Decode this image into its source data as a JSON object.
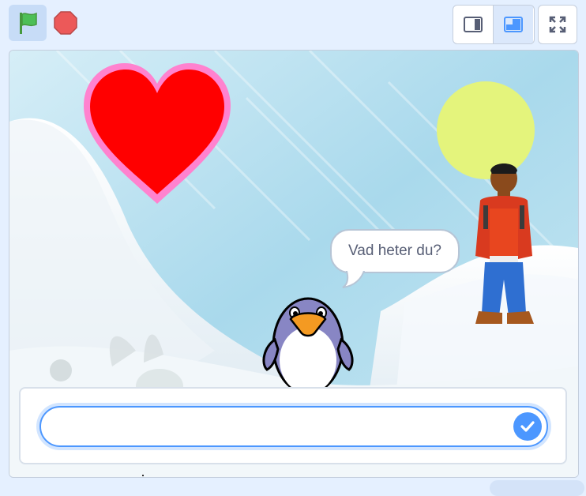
{
  "toolbar": {
    "green_flag_icon": "green-flag-icon",
    "stop_icon": "stop-icon",
    "small_stage_icon": "small-stage-icon",
    "normal_stage_icon": "normal-stage-icon",
    "fullscreen_icon": "fullscreen-icon",
    "active_mode": "normal-stage",
    "accent_color": "#4c97ff",
    "flag_color": "#4cbf56",
    "stop_color": "#ec5959"
  },
  "stage": {
    "backdrop": "winter",
    "sprites": [
      "heart",
      "sun",
      "penguin",
      "boy",
      "rabbit"
    ],
    "speech_bubble": {
      "text": "Vad heter du?"
    }
  },
  "ask_prompt": {
    "input_value": "",
    "submit_icon": "checkmark-icon"
  }
}
